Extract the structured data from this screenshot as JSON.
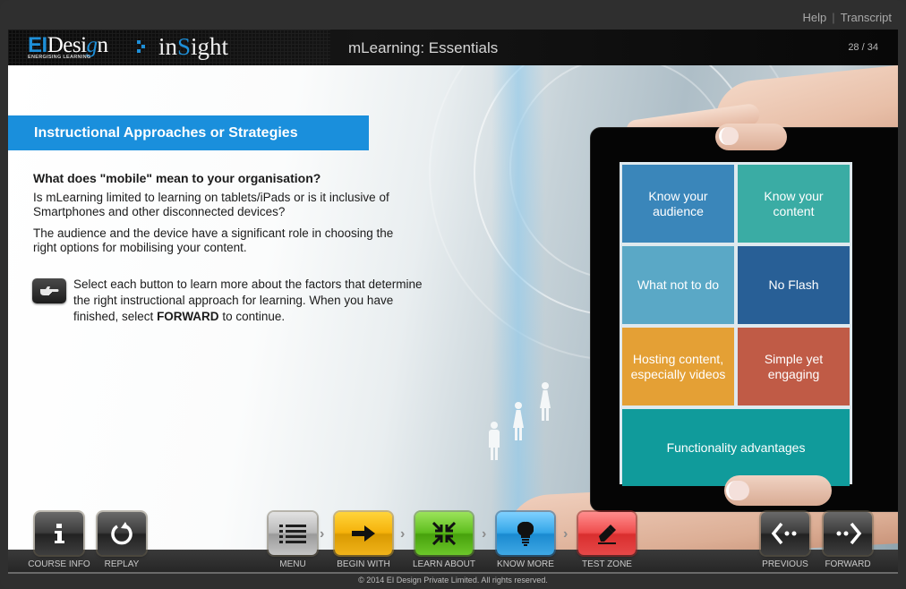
{
  "top_links": {
    "help": "Help",
    "separator": "|",
    "transcript": "Transcript"
  },
  "header": {
    "brand_ei": "EI",
    "brand_design_pre": "Desi",
    "brand_design_g": "g",
    "brand_design_post": "n",
    "brand_tagline": "ENERGISING LEARNING",
    "product_pre": "in",
    "product_s": "S",
    "product_post": "ight",
    "course_title": "mLearning: Essentials",
    "page_current": "28",
    "page_separator": "/",
    "page_total": "34"
  },
  "content": {
    "section_title": "Instructional Approaches or Strategies",
    "question": "What does \"mobile\" mean to your organisation?",
    "paragraph1": "Is mLearning limited to learning on tablets/iPads or is it inclusive of Smartphones and other disconnected devices?",
    "paragraph2": "The audience and the device have a significant role in choosing the right options for mobilising your content.",
    "instruction_pre": "Select each button to learn more about the factors that determine the right instructional approach for learning. When you have finished, select ",
    "instruction_bold": "FORWARD",
    "instruction_post": " to continue."
  },
  "tiles": [
    {
      "label": "Know your audience",
      "color": "#3a86ba"
    },
    {
      "label": "Know your content",
      "color": "#3aaca4"
    },
    {
      "label": "What not to do",
      "color": "#5aa8c6"
    },
    {
      "label": "No Flash",
      "color": "#285f96"
    },
    {
      "label": "Hosting content, especially videos",
      "color": "#e4a035"
    },
    {
      "label": "Simple yet engaging",
      "color": "#c05b46"
    },
    {
      "label": "Functionality advantages",
      "color": "#109b9b"
    }
  ],
  "nav": {
    "course_info": "COURSE INFO",
    "replay": "REPLAY",
    "menu": "MENU",
    "begin_with": "BEGIN WITH",
    "learn_about": "LEARN ABOUT",
    "know_more": "KNOW MORE",
    "test_zone": "TEST ZONE",
    "previous": "PREVIOUS",
    "forward": "FORWARD",
    "chevron": "›"
  },
  "footer": {
    "copyright": "© 2014 EI Design Private Limited. All rights reserved."
  }
}
